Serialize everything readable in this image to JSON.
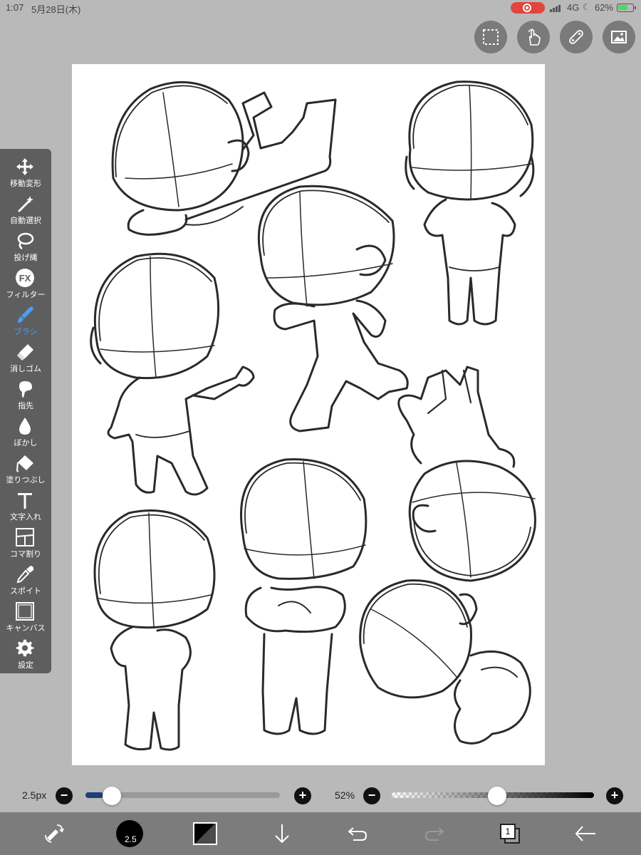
{
  "status_bar": {
    "time": "1:07",
    "date": "5月28日(木)",
    "network": "4G",
    "battery": "62%"
  },
  "top_tools": [
    "selection-icon",
    "gesture-hand-icon",
    "ruler-icon",
    "gallery-icon"
  ],
  "toolbar": {
    "items": [
      {
        "label": "移動変形",
        "icon": "move-transform-icon"
      },
      {
        "label": "自動選択",
        "icon": "magic-wand-icon"
      },
      {
        "label": "投げ縄",
        "icon": "lasso-icon"
      },
      {
        "label": "フィルター",
        "icon": "filter-fx-icon"
      },
      {
        "label": "ブラシ",
        "icon": "brush-icon",
        "active": true
      },
      {
        "label": "消しゴム",
        "icon": "eraser-icon"
      },
      {
        "label": "指先",
        "icon": "finger-smudge-icon"
      },
      {
        "label": "ぼかし",
        "icon": "blur-drop-icon"
      },
      {
        "label": "塗りつぶし",
        "icon": "fill-bucket-icon"
      },
      {
        "label": "文字入れ",
        "icon": "text-icon"
      },
      {
        "label": "コマ割り",
        "icon": "frame-divider-icon"
      },
      {
        "label": "スポイト",
        "icon": "eyedropper-icon"
      },
      {
        "label": "キャンバス",
        "icon": "canvas-icon"
      },
      {
        "label": "設定",
        "icon": "settings-gear-icon"
      }
    ],
    "active_color": "#4a9ef5"
  },
  "brush_size": {
    "value_label": "2.5px",
    "minus": "−",
    "plus": "+",
    "level": 0.09
  },
  "opacity": {
    "value_label": "52%",
    "minus": "−",
    "plus": "+",
    "level": 0.52
  },
  "bottom_bar": {
    "brush_preview_label": "2.5",
    "layer_count": "1",
    "icons": [
      "swap-tools-icon",
      "brush-size-preview",
      "color-swatch-icon",
      "download-arrow-icon",
      "undo-icon",
      "redo-icon",
      "layers-icon",
      "back-arrow-icon"
    ]
  }
}
